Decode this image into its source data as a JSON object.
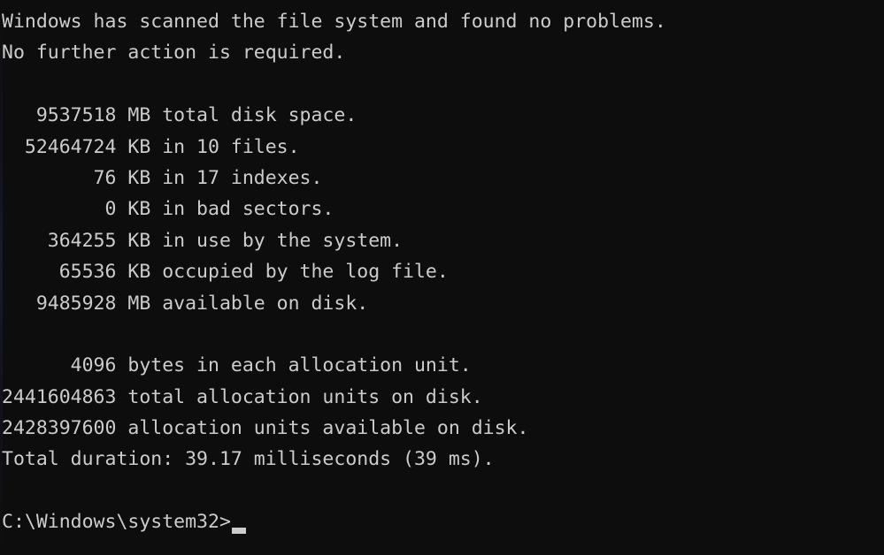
{
  "terminal": {
    "app": "Windows Command Prompt",
    "background_color": "#0d0d0e",
    "foreground_color": "#cccccc",
    "cursor_color": "#cccccc",
    "lines": [
      "Windows has scanned the file system and found no problems.",
      "No further action is required.",
      "",
      "   9537518 MB total disk space.",
      "  52464724 KB in 10 files.",
      "        76 KB in 17 indexes.",
      "         0 KB in bad sectors.",
      "    364255 KB in use by the system.",
      "     65536 KB occupied by the log file.",
      "   9485928 MB available on disk.",
      "",
      "      4096 bytes in each allocation unit.",
      "2441604863 total allocation units on disk.",
      "2428397600 allocation units available on disk.",
      "Total duration: 39.17 milliseconds (39 ms).",
      ""
    ],
    "prompt": "C:\\Windows\\system32>",
    "input_value": "",
    "cursor": "block-underline",
    "report": {
      "status_line_1": "Windows has scanned the file system and found no problems.",
      "status_line_2": "No further action is required.",
      "stats": [
        {
          "value": "9537518",
          "unit": "MB",
          "description": "total disk space."
        },
        {
          "value": "52464724",
          "unit": "KB",
          "description": "in 10 files."
        },
        {
          "value": "76",
          "unit": "KB",
          "description": "in 17 indexes."
        },
        {
          "value": "0",
          "unit": "KB",
          "description": "in bad sectors."
        },
        {
          "value": "364255",
          "unit": "KB",
          "description": "in use by the system."
        },
        {
          "value": "65536",
          "unit": "KB",
          "description": "occupied by the log file."
        },
        {
          "value": "9485928",
          "unit": "MB",
          "description": "available on disk."
        }
      ],
      "allocation": [
        {
          "value": "4096",
          "unit": "bytes",
          "description": "in each allocation unit."
        },
        {
          "value": "2441604863",
          "unit": "",
          "description": "total allocation units on disk."
        },
        {
          "value": "2428397600",
          "unit": "",
          "description": "allocation units available on disk."
        }
      ],
      "duration_label": "Total duration:",
      "duration_value": "39.17 milliseconds (39 ms)."
    }
  }
}
